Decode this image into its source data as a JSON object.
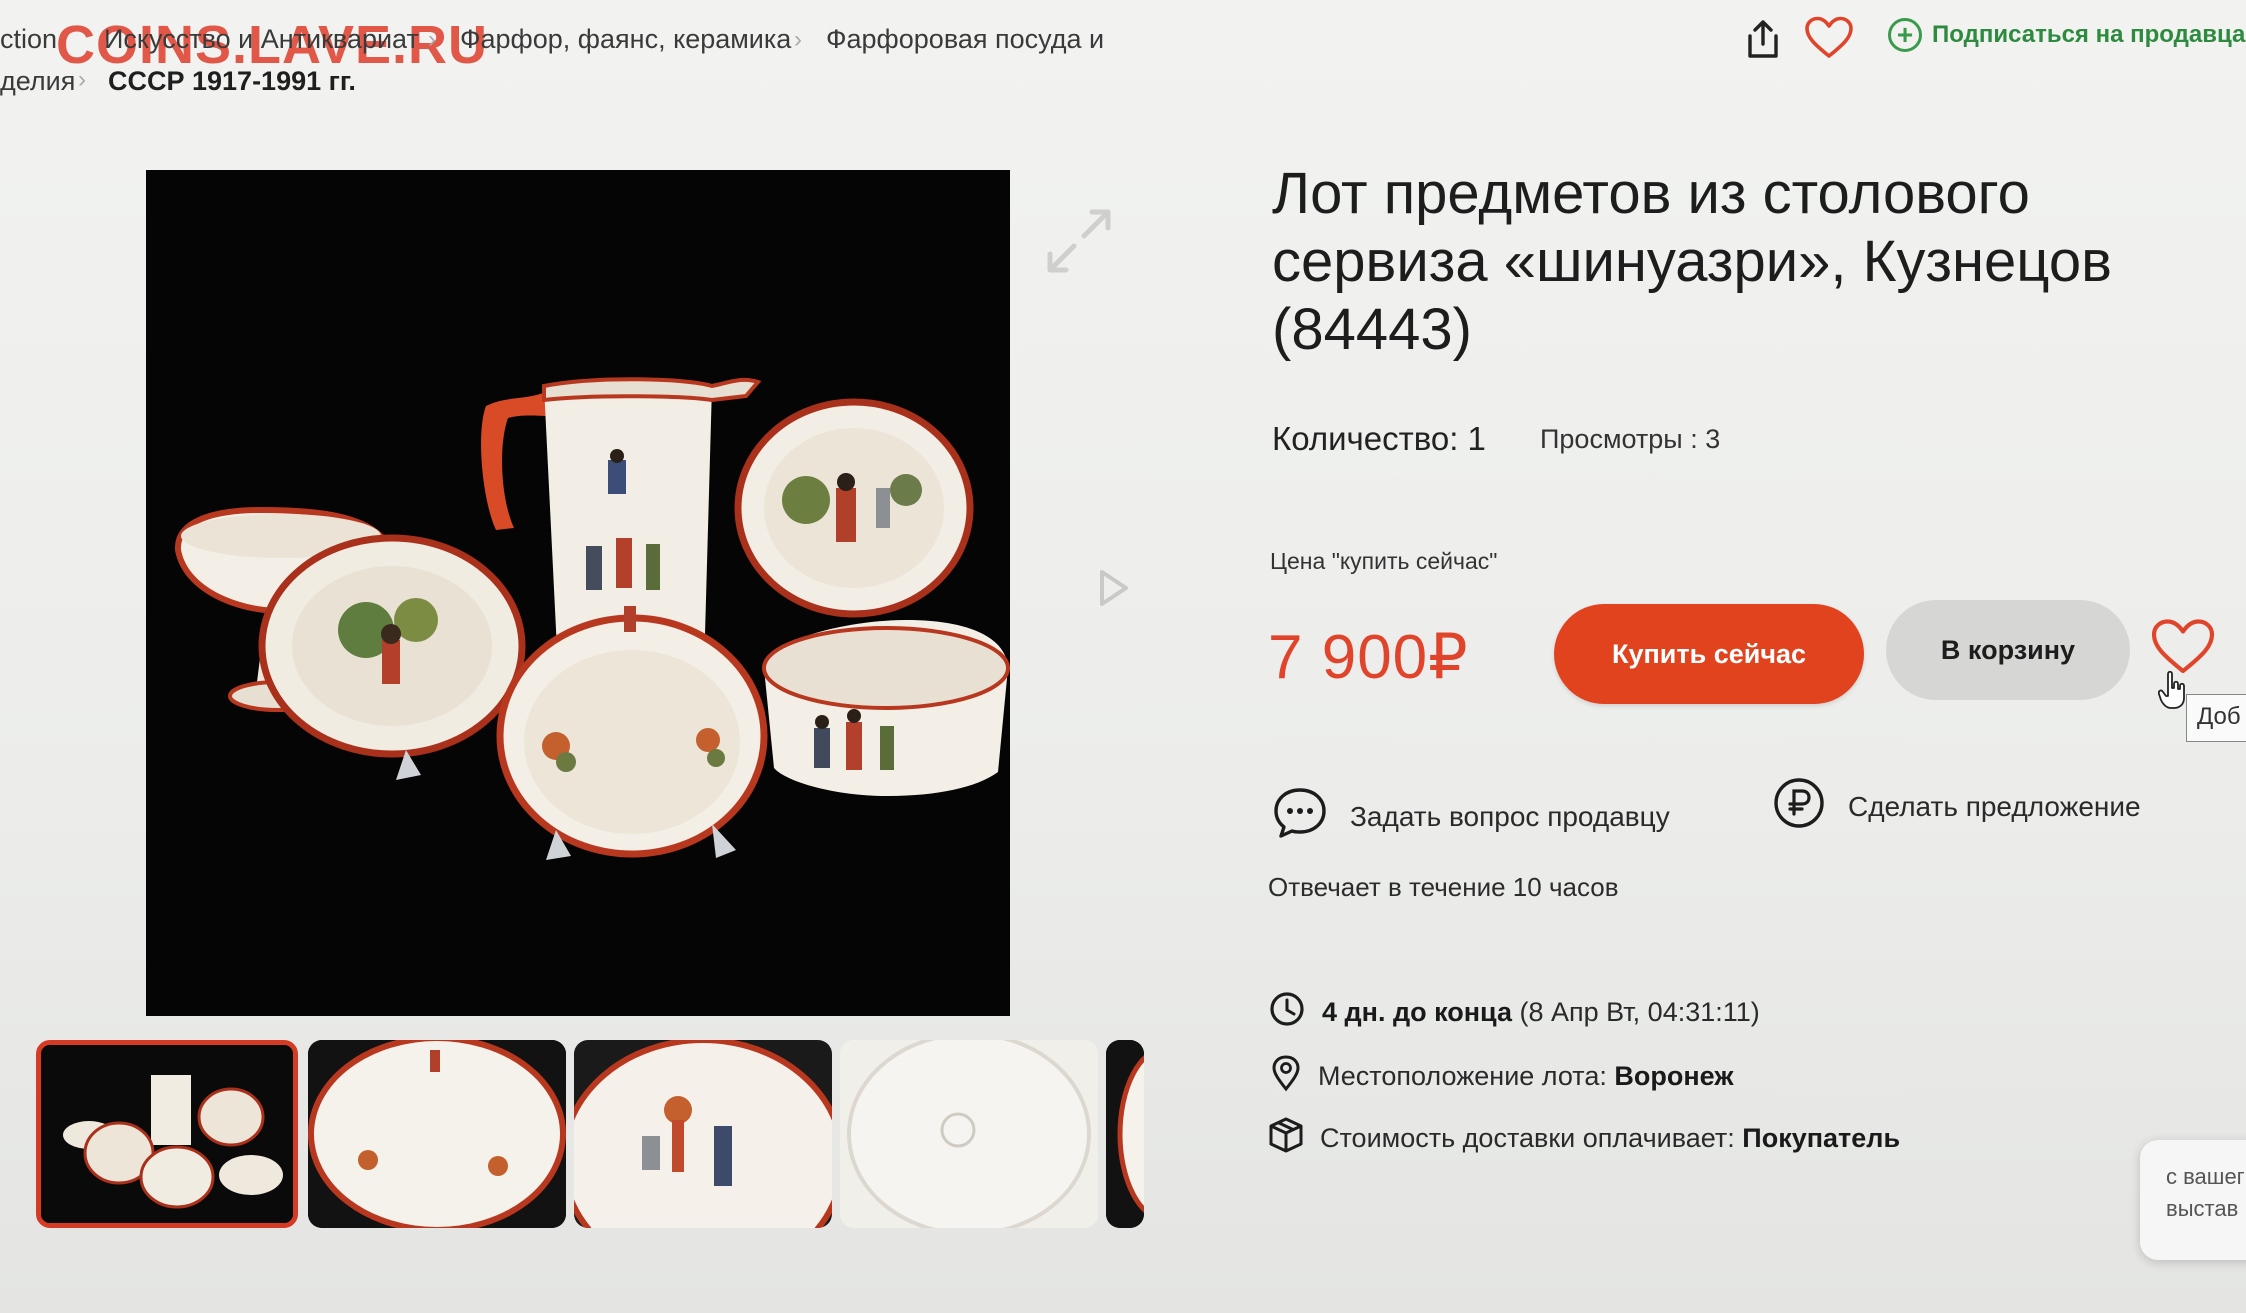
{
  "watermark": "COINS.LAVE.RU",
  "breadcrumb": {
    "row1": [
      "ction",
      "Искусство и Антиквариат",
      "Фарфор, фаянс, керамика",
      "Фарфоровая посуда и"
    ],
    "row2": [
      "делия",
      "СССР 1917-1991 гг."
    ]
  },
  "header": {
    "subscribe_label": "Подписаться на продавца",
    "icons": [
      "share-icon",
      "heart-icon",
      "plus-circle-icon"
    ]
  },
  "product": {
    "title": "Лот предметов из столового сервиза «шинуазри», Кузнецов (84443)",
    "quantity": "Количество: 1",
    "views": "Просмотры : 3",
    "price_label": "Цена \"купить сейчас\"",
    "price": "7 900₽"
  },
  "buttons": {
    "buy_now": "Купить сейчас",
    "add_to_cart": "В корзину"
  },
  "tooltip": "Доб",
  "actions": {
    "ask_seller": "Задать вопрос продавцу",
    "make_offer": "Сделать предложение",
    "reply_time": "Отвечает в течение 10 часов"
  },
  "info": {
    "time_left_bold": "4 дн. до конца",
    "time_left_date": "(8 Апр Вт, 04:31:11)",
    "location_label": "Местоположение лота:",
    "location_value": "Воронеж",
    "shipping_label": "Стоимость доставки оплачивает:",
    "shipping_value": "Покупатель"
  },
  "side_widget": {
    "line1": "с вашег",
    "line2": "выстав"
  },
  "colors": {
    "accent": "#e2431f",
    "price": "#e0452c",
    "subscribe": "#2d8a3f"
  }
}
